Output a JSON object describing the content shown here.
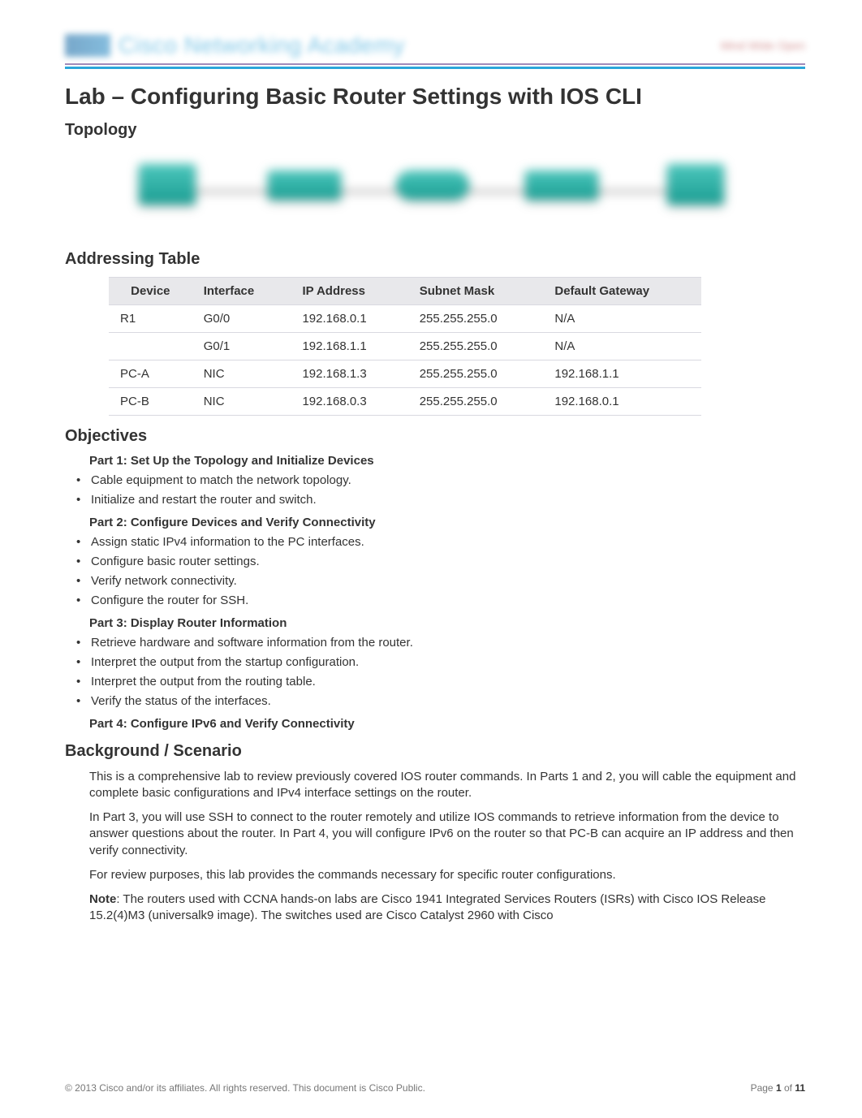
{
  "header": {
    "logo_text": "Cisco Networking Academy",
    "top_right": "Mind Wide Open"
  },
  "title": "Lab – Configuring Basic Router Settings with IOS CLI",
  "sections": {
    "topology": "Topology",
    "addressing": "Addressing Table",
    "objectives": "Objectives",
    "background": "Background / Scenario"
  },
  "addressing_table": {
    "headers": [
      "Device",
      "Interface",
      "IP Address",
      "Subnet Mask",
      "Default Gateway"
    ],
    "rows": [
      [
        "R1",
        "G0/0",
        "192.168.0.1",
        "255.255.255.0",
        "N/A"
      ],
      [
        "",
        "G0/1",
        "192.168.1.1",
        "255.255.255.0",
        "N/A"
      ],
      [
        "PC-A",
        "NIC",
        "192.168.1.3",
        "255.255.255.0",
        "192.168.1.1"
      ],
      [
        "PC-B",
        "NIC",
        "192.168.0.3",
        "255.255.255.0",
        "192.168.0.1"
      ]
    ]
  },
  "objectives": {
    "part1": {
      "title": "Part 1: Set Up the Topology and Initialize Devices",
      "items": [
        "Cable equipment to match the network topology.",
        "Initialize and restart the router and switch."
      ]
    },
    "part2": {
      "title": "Part 2: Configure Devices and Verify Connectivity",
      "items": [
        "Assign static IPv4 information to the PC interfaces.",
        "Configure basic router settings.",
        "Verify network connectivity.",
        "Configure the router for SSH."
      ]
    },
    "part3": {
      "title": "Part 3: Display Router Information",
      "items": [
        "Retrieve hardware and software information from the router.",
        "Interpret the output from the startup configuration.",
        "Interpret the output from the routing table.",
        "Verify the status of the interfaces."
      ]
    },
    "part4": {
      "title": "Part 4: Configure IPv6 and Verify Connectivity",
      "items": []
    }
  },
  "background_paragraphs": [
    "This is a comprehensive lab to review previously covered IOS router commands. In Parts 1 and 2, you will cable the equipment and complete basic configurations and IPv4 interface settings on the router.",
    "In Part 3, you will use SSH to connect to the router remotely and utilize IOS commands to retrieve information from the device to answer questions about the router. In Part 4, you will configure IPv6 on the router so that PC-B can acquire an IP address and then verify connectivity.",
    "For review purposes, this lab provides the commands necessary for specific router configurations."
  ],
  "background_note": {
    "bold": "Note",
    "text": ": The routers used with CCNA hands-on labs are Cisco 1941 Integrated Services Routers (ISRs) with Cisco IOS Release 15.2(4)M3 (universalk9 image). The switches used are Cisco Catalyst 2960 with Cisco"
  },
  "footer": {
    "copyright": "© 2013 Cisco and/or its affiliates. All rights reserved. This document is Cisco Public.",
    "page_label_a": "Page ",
    "page_num": "1",
    "page_label_b": " of ",
    "page_total": "11"
  }
}
